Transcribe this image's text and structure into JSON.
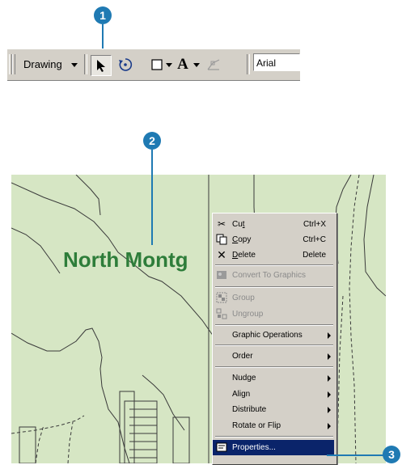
{
  "callouts": {
    "one": "1",
    "two": "2",
    "three": "3"
  },
  "toolbar": {
    "drawing_label": "Drawing",
    "font_value": "Arial",
    "icons": [
      "dropdown-arrow-icon",
      "select-pointer-icon",
      "rotate-icon",
      "rectangle-icon",
      "text-A-icon",
      "edit-vertices-icon"
    ]
  },
  "map": {
    "label": "North Montg",
    "background": "#d6e6c4",
    "label_color": "#2e7d3a"
  },
  "menu": {
    "cut": {
      "label_pre": "Cu",
      "label_ul": "t",
      "label_post": "",
      "shortcut": "Ctrl+X"
    },
    "copy": {
      "label_pre": "",
      "label_ul": "C",
      "label_post": "opy",
      "shortcut": "Ctrl+C"
    },
    "delete": {
      "label_pre": "",
      "label_ul": "D",
      "label_post": "elete",
      "shortcut": "Delete"
    },
    "convert": "Convert To Graphics",
    "group": "Group",
    "ungroup": "Ungroup",
    "graphic_ops": "Graphic Operations",
    "order": "Order",
    "nudge": "Nudge",
    "align": "Align",
    "distribute": "Distribute",
    "rotate_flip": "Rotate or Flip",
    "properties": "Properties...",
    "highlight_color": "#0a246a"
  },
  "accent": "#1f7ab3"
}
